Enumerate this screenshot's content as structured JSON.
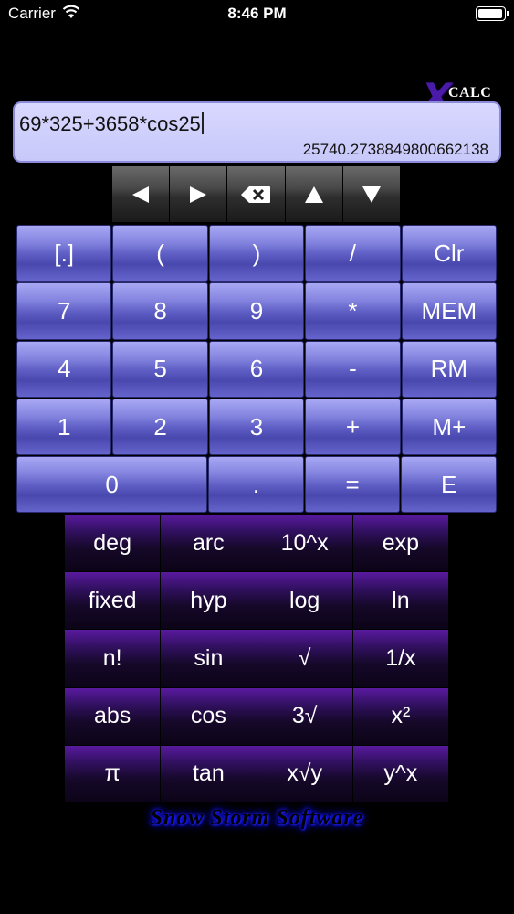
{
  "status_bar": {
    "carrier": "Carrier",
    "time": "8:46 PM",
    "battery_level": 1.0
  },
  "logo": {
    "x_mark": "X",
    "text": "CALC"
  },
  "display": {
    "expression": "69*325+3658*cos25",
    "result": "25740.273884980066213­8"
  },
  "arrow_keys": [
    {
      "icon": "arrow-left-icon"
    },
    {
      "icon": "arrow-right-icon"
    },
    {
      "icon": "backspace-icon"
    },
    {
      "icon": "arrow-up-icon"
    },
    {
      "icon": "arrow-down-icon"
    }
  ],
  "keypad": {
    "rows": [
      [
        "[.]",
        "(",
        ")",
        "/",
        "Clr"
      ],
      [
        "7",
        "8",
        "9",
        "*",
        "MEM"
      ],
      [
        "4",
        "5",
        "6",
        "-",
        "RM"
      ],
      [
        "1",
        "2",
        "3",
        "+",
        "M+"
      ],
      [
        "0",
        ".",
        "=",
        "E"
      ]
    ]
  },
  "function_keys": {
    "rows": [
      [
        "deg",
        "arc",
        "10^x",
        "exp"
      ],
      [
        "fixed",
        "hyp",
        "log",
        "ln"
      ],
      [
        "n!",
        "sin",
        "√",
        "1/x"
      ],
      [
        "abs",
        "cos",
        "3√",
        "x²"
      ],
      [
        "π",
        "tan",
        "x√y",
        "y^x"
      ]
    ]
  },
  "footer": {
    "brand": "Snow Storm Software"
  },
  "colors": {
    "background": "#000000",
    "display_bg": "#d0d0fc",
    "keypad_blue": "#6a6ad0",
    "function_purple": "#30105e"
  }
}
